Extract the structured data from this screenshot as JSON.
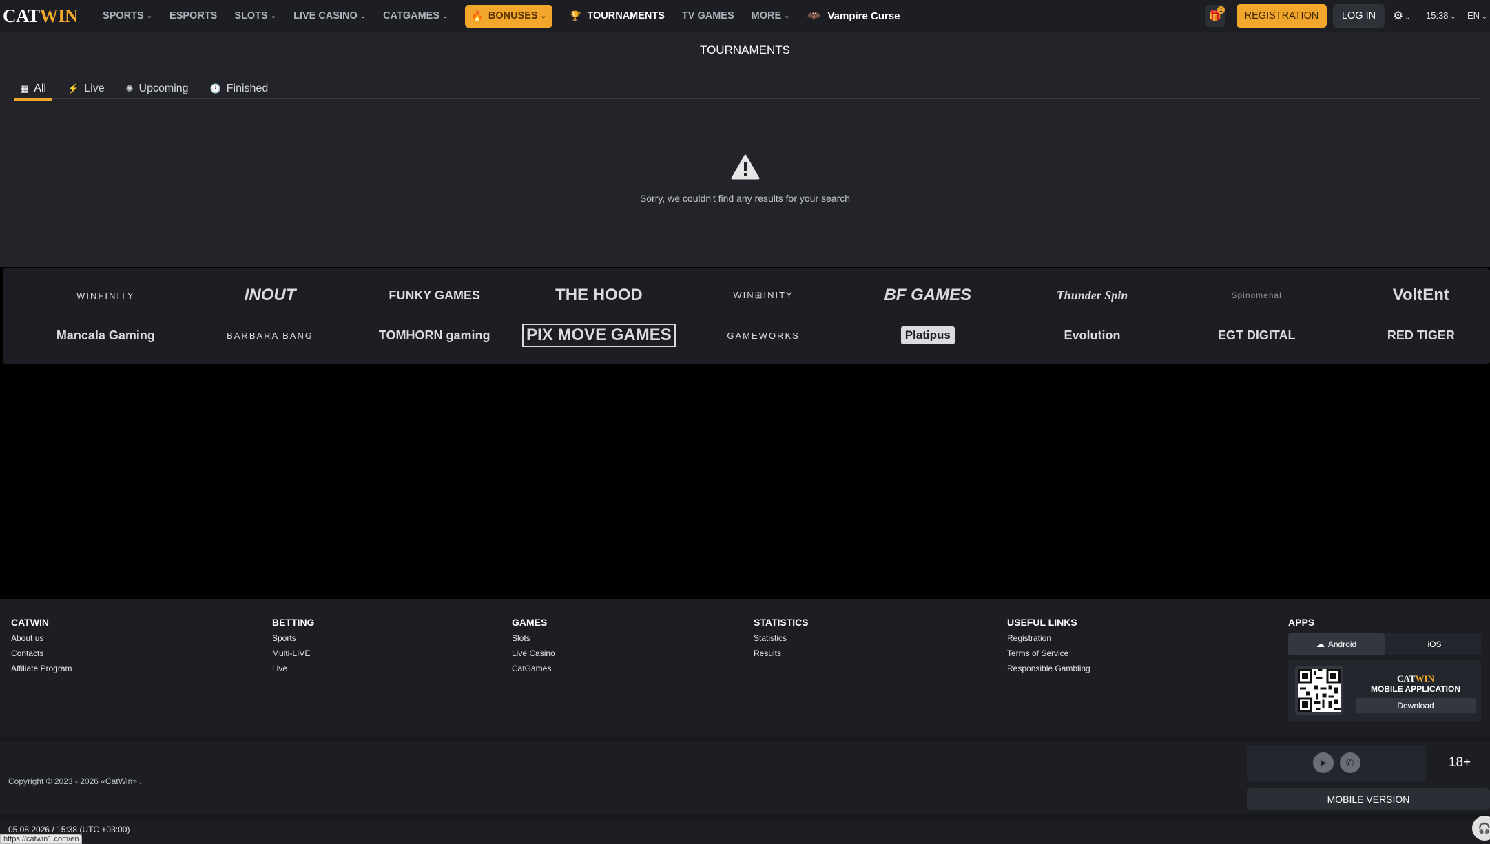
{
  "header": {
    "logo_left": "CAT",
    "logo_right": "WIN",
    "nav": [
      {
        "label": "SPORTS",
        "chev": true
      },
      {
        "label": "ESPORTS",
        "chev": false
      },
      {
        "label": "SLOTS",
        "chev": true
      },
      {
        "label": "LIVE CASINO",
        "chev": true
      },
      {
        "label": "CATGAMES",
        "chev": true
      }
    ],
    "bonuses": "BONUSES",
    "tournaments": "TOURNAMENTS",
    "tv_games": "TV GAMES",
    "more": "MORE",
    "featured_game": "Vampire Curse",
    "gift_count": "1",
    "registration": "REGISTRATION",
    "login": "LOG IN",
    "time": "15:38",
    "lang": "EN"
  },
  "page": {
    "title": "TOURNAMENTS",
    "tabs": [
      {
        "label": "All",
        "icon": "grid-icon",
        "active": true
      },
      {
        "label": "Live",
        "icon": "lightning-icon",
        "active": false
      },
      {
        "label": "Upcoming",
        "icon": "soon-icon",
        "active": false
      },
      {
        "label": "Finished",
        "icon": "clock-icon",
        "active": false
      }
    ],
    "empty_message": "Sorry, we couldn't find any results for your search"
  },
  "providers": [
    "WINFINITY",
    "INOUT",
    "FUNKY GAMES",
    "THE HOOD",
    "WIN⊞INITY",
    "BF GAMES",
    "Thunder Spin",
    "Spinomenal",
    "VoltEnt",
    "Mancala Gaming",
    "BARBARA BANG",
    "TOMHORN gaming",
    "PIX MOVE GAMES",
    "GAMEWORKS",
    "Platipus",
    "Evolution",
    "EGT DIGITAL",
    "RED TIGER"
  ],
  "footer": {
    "columns": [
      {
        "title": "CATWIN",
        "links": [
          "About us",
          "Contacts",
          "Affiliate Program"
        ]
      },
      {
        "title": "BETTING",
        "links": [
          "Sports",
          "Multi-LIVE",
          "Live"
        ]
      },
      {
        "title": "GAMES",
        "links": [
          "Slots",
          "Live Casino",
          "CatGames"
        ]
      },
      {
        "title": "STATISTICS",
        "links": [
          "Statistics",
          "Results"
        ]
      },
      {
        "title": "USEFUL LINKS",
        "links": [
          "Registration",
          "Terms of Service",
          "Responsible Gambling"
        ]
      }
    ],
    "apps": {
      "title": "APPS",
      "android": "Android",
      "ios": "iOS",
      "app_label": "MOBILE APPLICATION",
      "download": "Download"
    },
    "copyright": "Copyright © 2023 - 2026 «CatWin» .",
    "age": "18+",
    "mobile_version": "MOBILE VERSION",
    "datetime": "05.08.2026 / 15:38 (UTC +03:00)"
  },
  "status_url": "https://catwin1.com/en",
  "colors": {
    "accent": "#f3a62c",
    "bg_header": "#1c1e23",
    "bg_main": "#22242a"
  }
}
